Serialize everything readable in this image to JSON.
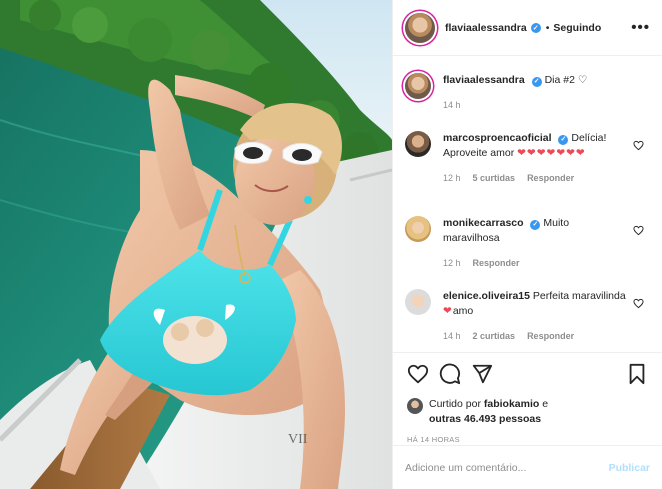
{
  "post": {
    "username": "flaviaalessandra",
    "follow_separator": "•",
    "follow_label": "Seguindo",
    "more_label": "•••",
    "verified_glyph": "✓"
  },
  "caption": {
    "username": "flaviaalessandra",
    "text": "Dia #2 ♡",
    "time": "14 h"
  },
  "comments": [
    {
      "username": "marcosproencaoficial",
      "verified": true,
      "text": "Delícia! Aproveite amor ",
      "hearts": "❤❤❤❤❤❤❤",
      "time": "12 h",
      "likes": "5 curtidas",
      "reply": "Responder"
    },
    {
      "username": "monikecarrasco",
      "verified": true,
      "text": "Muito maravilhosa",
      "hearts": "",
      "time": "12 h",
      "likes": "",
      "reply": "Responder"
    },
    {
      "username": "elenice.oliveira15",
      "verified": false,
      "text": "Perfeita maravilinda",
      "hearts": "❤",
      "text_after": "amo",
      "time": "14 h",
      "likes": "2 curtidas",
      "reply": "Responder"
    }
  ],
  "likes": {
    "prefix": "Curtido por",
    "user": "fabiokamio",
    "mid": "e",
    "others": "outras 46.493 pessoas"
  },
  "timestamp": "HÁ 14 HORAS",
  "composer": {
    "placeholder": "Adicione um comentário...",
    "publish_label": "Publicar"
  },
  "icons": {
    "like": "heart-icon",
    "comment": "comment-icon",
    "share": "share-icon",
    "save": "bookmark-icon",
    "comment_like": "heart-icon"
  },
  "colors": {
    "verified": "#3897f0",
    "heart": "#ed4956",
    "publish_disabled": "#b2dffc",
    "muted": "#8e8e8e",
    "swimsuit": "#33d6e0"
  },
  "photo_tattoo": "VII"
}
